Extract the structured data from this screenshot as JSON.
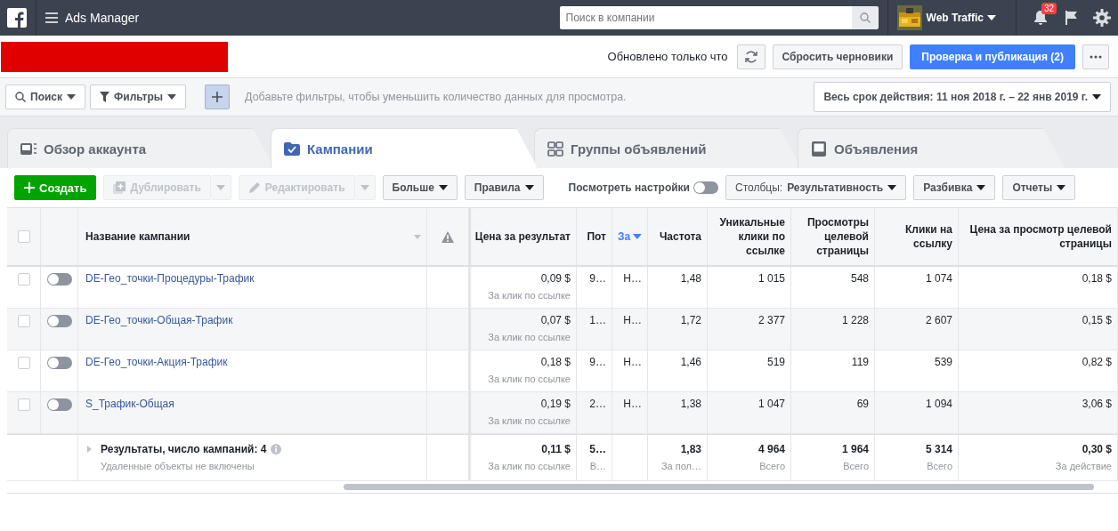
{
  "top_bar": {
    "app_title": "Ads Manager",
    "search": {
      "placeholder": "Поиск в компании"
    },
    "account": "Web Traffic",
    "notifications": "32"
  },
  "header": {
    "status": "Обновлено только что",
    "discard": "Сбросить черновики",
    "publish": "Проверка и публикация (2)"
  },
  "filter_bar": {
    "search": "Поиск",
    "filters": "Фильтры",
    "hint": "Добавьте фильтры, чтобы уменьшить количество данных для просмотра.",
    "date_range": "Весь срок действия: 11 ноя 2018 г. – 22 янв 2019 г."
  },
  "tabs": [
    {
      "label": "Обзор аккаунта",
      "kind": "overview",
      "selected": false
    },
    {
      "label": "Кампании",
      "kind": "campaigns",
      "selected": true
    },
    {
      "label": "Группы объявлений",
      "kind": "adsets",
      "selected": false
    },
    {
      "label": "Объявления",
      "kind": "ads",
      "selected": false
    }
  ],
  "toolbar": {
    "create": "Создать",
    "duplicate": {
      "label": "Дублировать",
      "disabled": true
    },
    "edit": {
      "label": "Редактировать",
      "disabled": true
    },
    "more": "Больше",
    "rules": "Правила",
    "view_settings": {
      "label": "Посмотреть настройки",
      "on": false
    },
    "columns": {
      "label": "Столбцы:",
      "value": "Результативность"
    },
    "breakdown": "Разбивка",
    "reports": "Отчеты"
  },
  "table": {
    "all_selected": false,
    "columns": [
      {
        "label": "Название кампании",
        "kind": "name",
        "sorted": false
      },
      {
        "kind": "warning",
        "sorted": false
      },
      {
        "label": "Цена за результат",
        "kind": "num",
        "sorted": false
      },
      {
        "label": "Пот",
        "kind": "num",
        "sorted": false
      },
      {
        "label": "За",
        "kind": "num",
        "sorted": true
      },
      {
        "label": "Частота",
        "kind": "num",
        "sorted": false
      },
      {
        "label": "Уникальные клики по ссылке",
        "kind": "num",
        "sorted": false
      },
      {
        "label": "Просмотры целевой страницы",
        "kind": "num",
        "sorted": false
      },
      {
        "label": "Клики на ссылку",
        "kind": "num",
        "sorted": false
      },
      {
        "label": "Цена за просмотр целевой страницы",
        "kind": "num",
        "sorted": false
      }
    ],
    "rows": [
      {
        "selected": false,
        "on": false,
        "cells": [
          {
            "value": "DE-Гео_точки-Процедуры-Трафик"
          },
          null,
          {
            "value": "0,09 $",
            "note": "За клик по ссылке"
          },
          {
            "value": "9…"
          },
          {
            "value": "Н…"
          },
          {
            "value": "1,48"
          },
          {
            "value": "1 015"
          },
          {
            "value": "548"
          },
          {
            "value": "1 074"
          },
          {
            "value": "0,18 $"
          }
        ]
      },
      {
        "selected": false,
        "on": false,
        "cells": [
          {
            "value": "DE-Гео_точки-Общая-Трафик"
          },
          null,
          {
            "value": "0,07 $",
            "note": "За клик по ссылке"
          },
          {
            "value": "1…"
          },
          {
            "value": "Н…"
          },
          {
            "value": "1,72"
          },
          {
            "value": "2 377"
          },
          {
            "value": "1 228"
          },
          {
            "value": "2 607"
          },
          {
            "value": "0,15 $"
          }
        ]
      },
      {
        "selected": false,
        "on": false,
        "cells": [
          {
            "value": "DE-Гео_точки-Акция-Трафик"
          },
          null,
          {
            "value": "0,18 $",
            "note": "За клик по ссылке"
          },
          {
            "value": "9…"
          },
          {
            "value": "Н…"
          },
          {
            "value": "1,46"
          },
          {
            "value": "519"
          },
          {
            "value": "119"
          },
          {
            "value": "539"
          },
          {
            "value": "0,82 $"
          }
        ]
      },
      {
        "selected": false,
        "on": false,
        "cells": [
          {
            "value": "S_Трафик-Общая"
          },
          null,
          {
            "value": "0,19 $",
            "note": "За клик по ссылке"
          },
          {
            "value": "2…"
          },
          {
            "value": "Н…"
          },
          {
            "value": "1,38"
          },
          {
            "value": "1 047"
          },
          {
            "value": "69"
          },
          {
            "value": "1 094"
          },
          {
            "value": "3,06 $"
          }
        ]
      }
    ],
    "summary": {
      "cells": [
        {
          "value": "Результаты, число кампаний: 4",
          "note": "Удаленные объекты не включены"
        },
        null,
        {
          "value": "0,11 $",
          "note": "За клик по ссылке"
        },
        {
          "value": "5…",
          "note": "В…"
        },
        null,
        {
          "value": "1,83",
          "note": "За пол…"
        },
        {
          "value": "4 964",
          "note": "Всего"
        },
        {
          "value": "1 964",
          "note": "Всего"
        },
        {
          "value": "5 314",
          "note": "Всего"
        },
        {
          "value": "0,30 $",
          "note": "За действие"
        }
      ]
    }
  }
}
